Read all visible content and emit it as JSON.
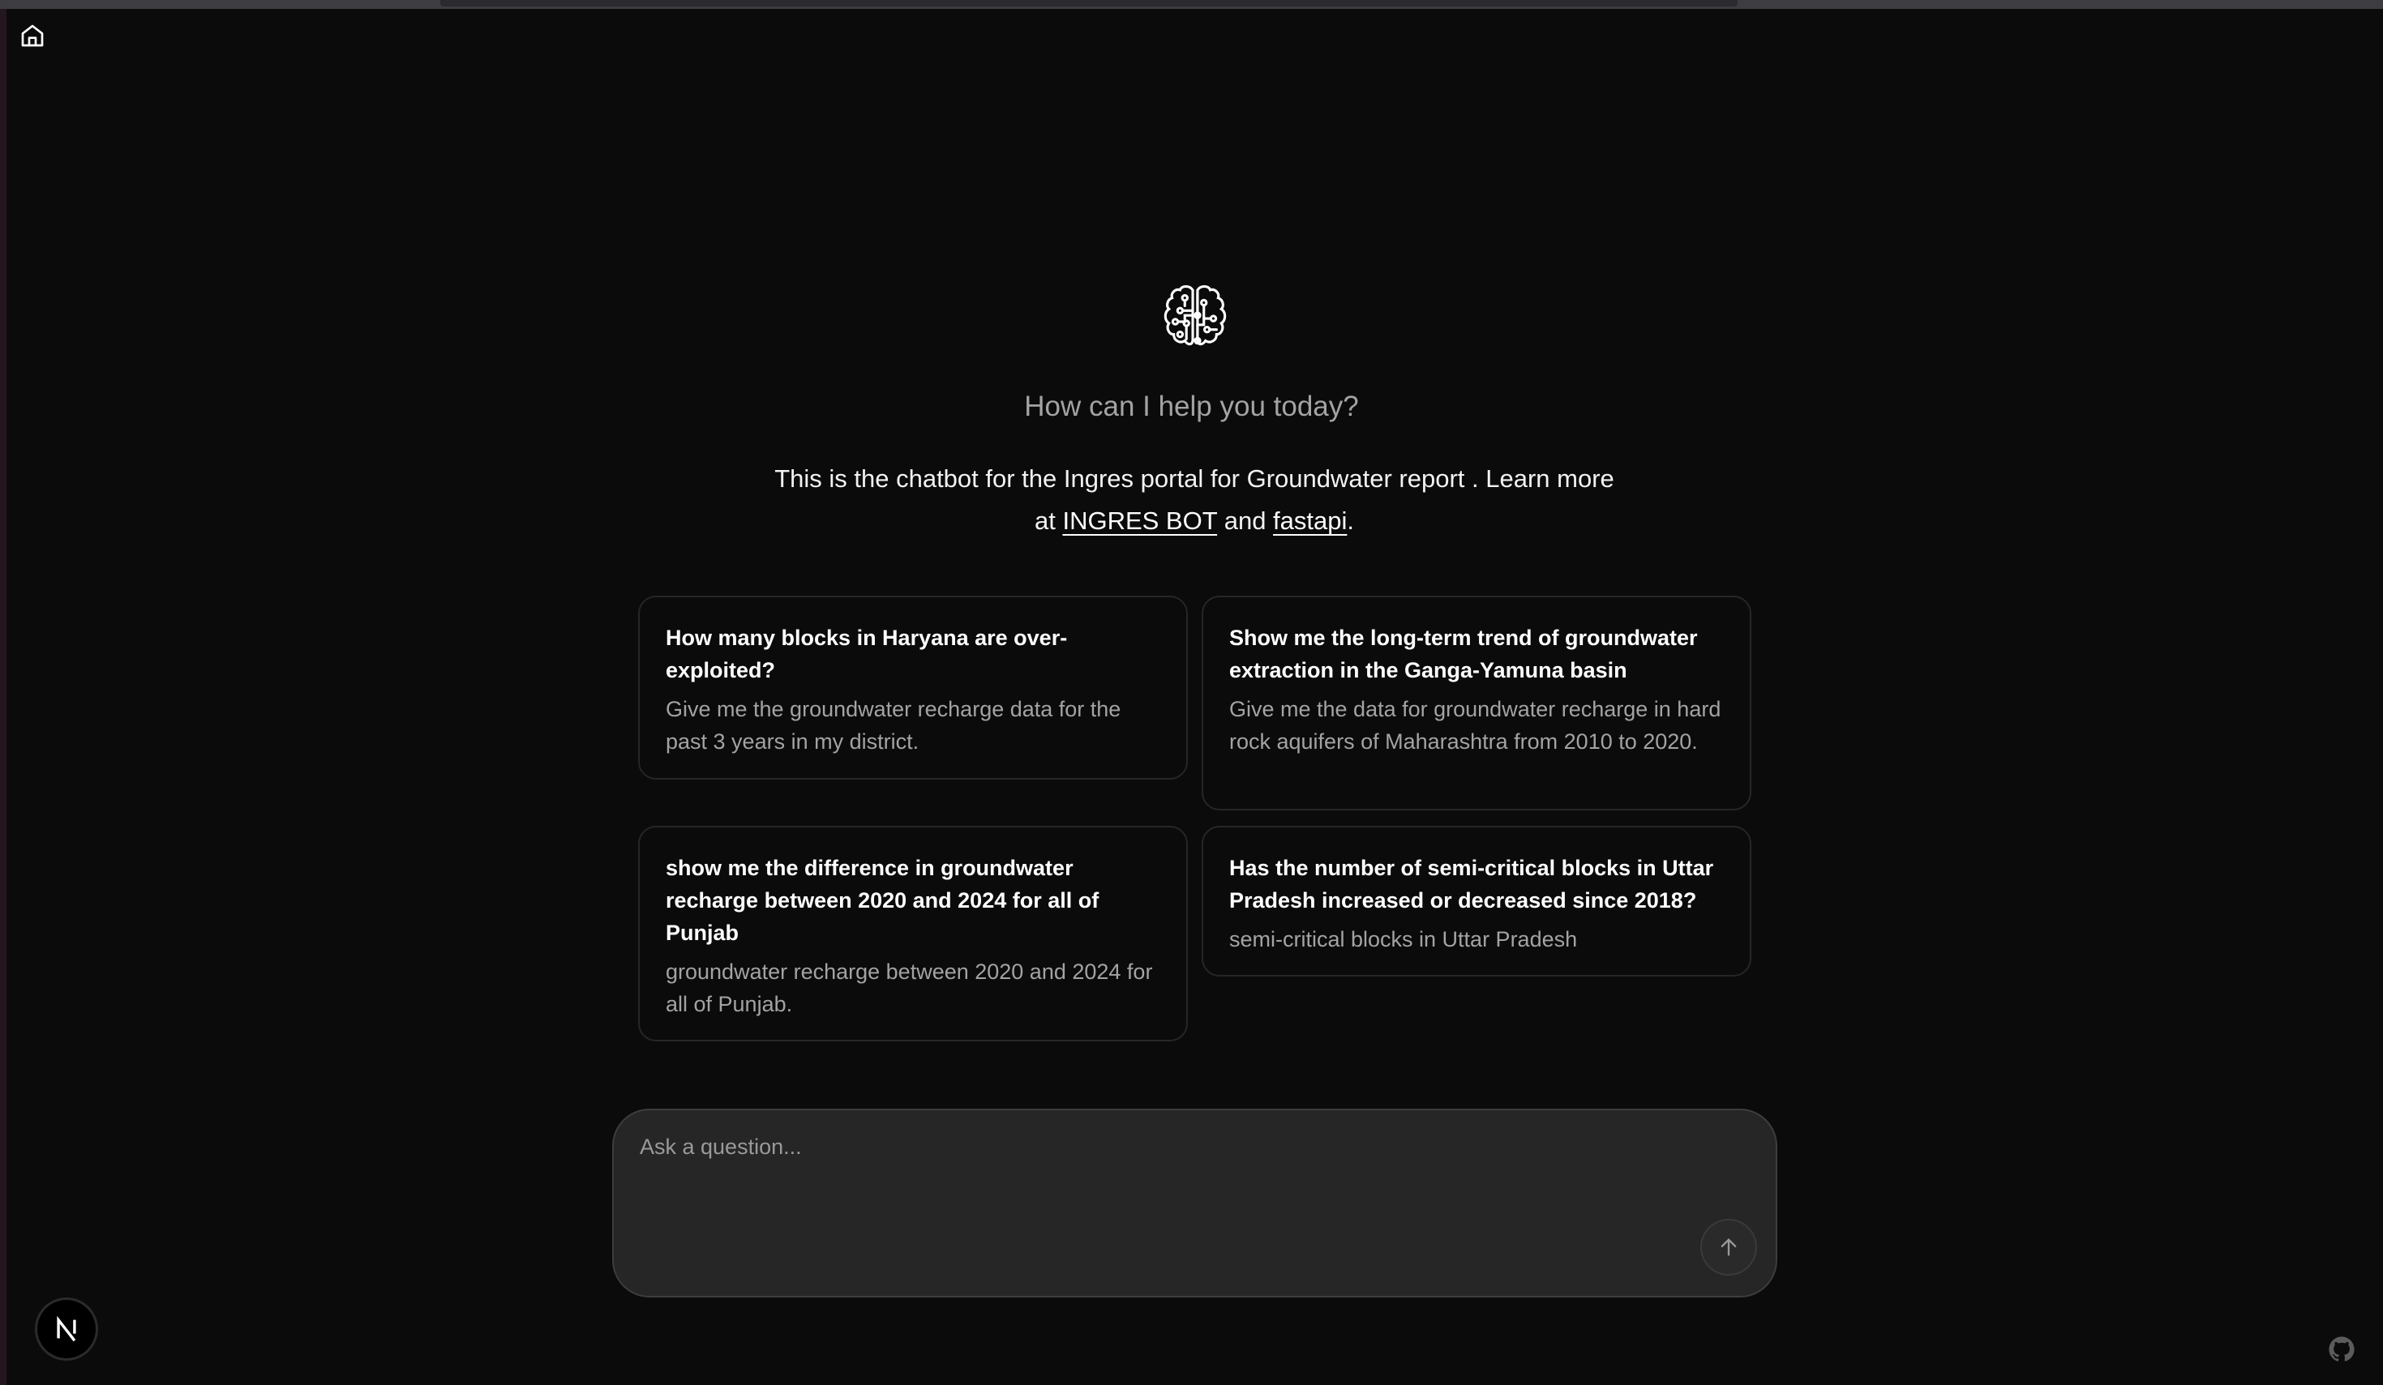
{
  "header": {
    "home_icon": "home-icon"
  },
  "hero": {
    "icon": "brain-circuit-icon",
    "greeting": "How can I help you today?",
    "description_prefix": "This is the chatbot for the Ingres portal for Groundwater report . Learn more at ",
    "link1": "INGRES BOT",
    "and": " and ",
    "link2": "fastapi",
    "suffix": "."
  },
  "suggestions": [
    {
      "title": "How many blocks in Haryana are over-exploited?",
      "subtitle": "Give me the groundwater recharge data for the past 3 years in my district."
    },
    {
      "title": "Show me the long-term trend of groundwater extraction in the Ganga-Yamuna basin",
      "subtitle": "Give me the data for groundwater recharge in hard rock aquifers of Maharashtra from 2010 to 2020."
    },
    {
      "title": "show me the difference in groundwater recharge between 2020 and 2024 for all of Punjab",
      "subtitle": "groundwater recharge between 2020 and 2024 for all of Punjab."
    },
    {
      "title": "Has the number of semi-critical blocks in Uttar Pradesh increased or decreased since 2018?",
      "subtitle": "semi-critical blocks in Uttar Pradesh"
    }
  ],
  "composer": {
    "placeholder": "Ask a question...",
    "value": "",
    "send_icon": "arrow-up-icon"
  },
  "footer": {
    "nextjs_logo": "N",
    "github_icon": "github-icon"
  }
}
